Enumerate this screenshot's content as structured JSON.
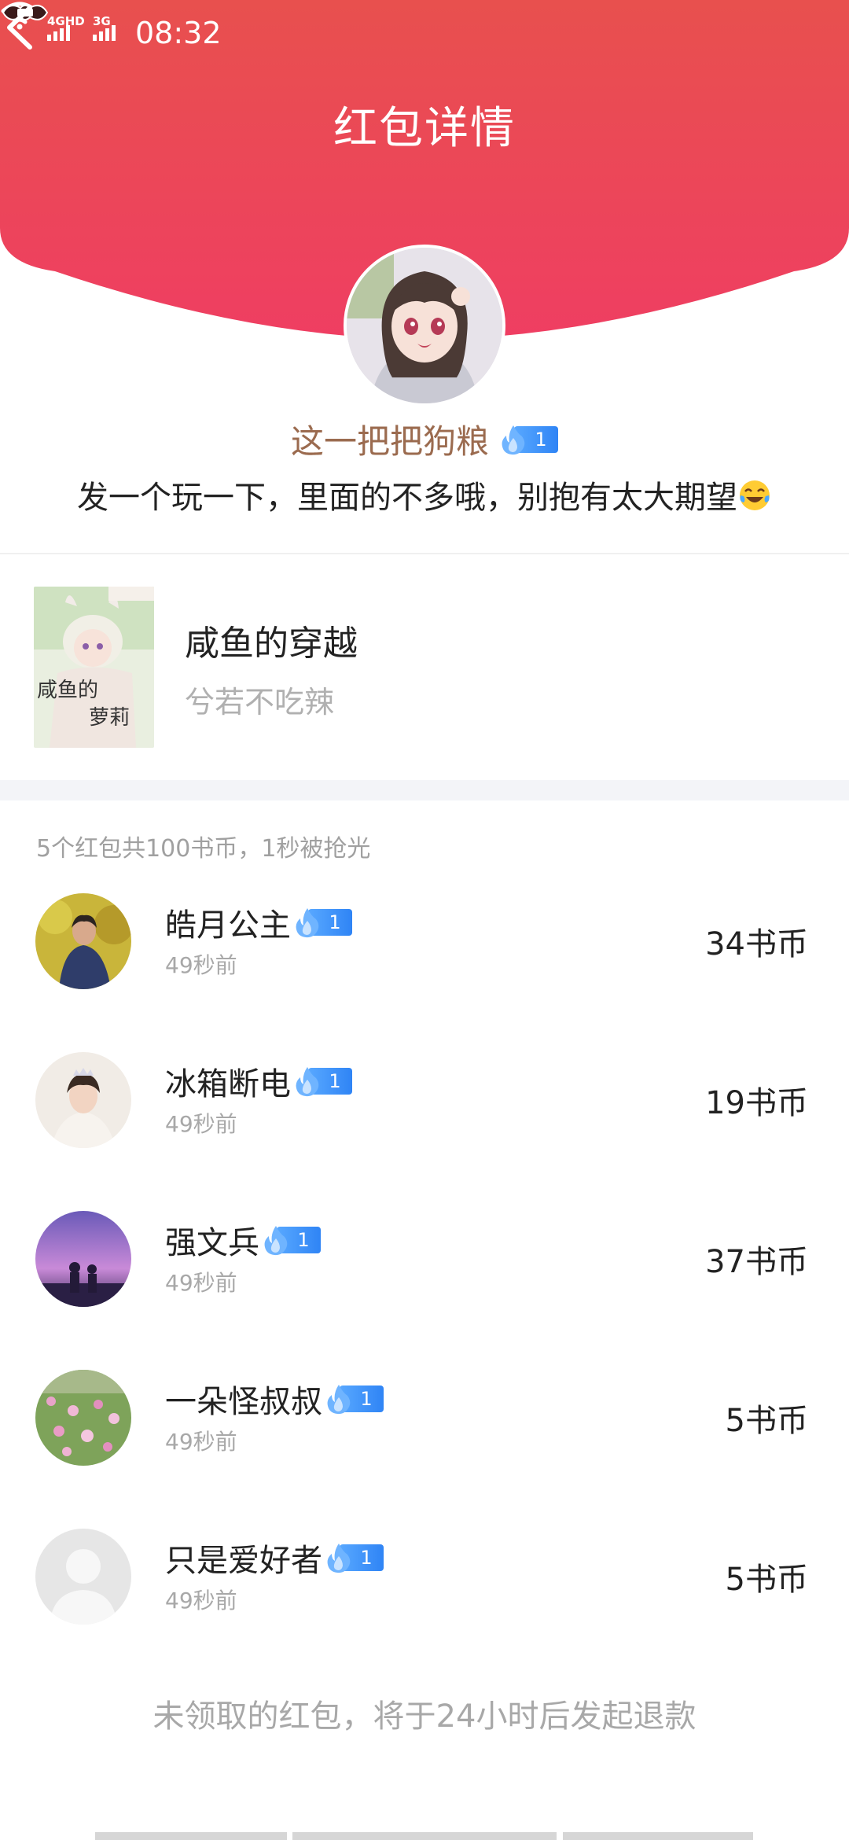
{
  "status_bar": {
    "network_1": "4GHD",
    "network_2": "3G",
    "time": "08:32"
  },
  "header": {
    "title": "红包详情",
    "back_icon": "chevron-left-icon",
    "gradient_top": "#e8504e",
    "gradient_bottom": "#ee3f5f"
  },
  "sender": {
    "name": "这一把把狗粮",
    "level": "1",
    "message": "发一个玩一下，里面的不多哦，别抱有太大期望",
    "emoji": "tears-of-joy-emoji"
  },
  "book": {
    "title": "咸鱼的穿越",
    "author": "兮若不吃辣",
    "cover_text": "咸鱼的 萝莉"
  },
  "summary": "5个红包共100书币，1秒被抢光",
  "receivers": [
    {
      "name": "皓月公主",
      "level": "1",
      "time": "49秒前",
      "amount": "34书币"
    },
    {
      "name": "冰箱断电",
      "level": "1",
      "time": "49秒前",
      "amount": "19书币"
    },
    {
      "name": "强文兵",
      "level": "1",
      "time": "49秒前",
      "amount": "37书币"
    },
    {
      "name": "一朵怪叔叔",
      "level": "1",
      "time": "49秒前",
      "amount": "5书币"
    },
    {
      "name": "只是爱好者",
      "level": "1",
      "time": "49秒前",
      "amount": "5书币"
    }
  ],
  "footer_note": "未领取的红包，将于24小时后发起退款"
}
